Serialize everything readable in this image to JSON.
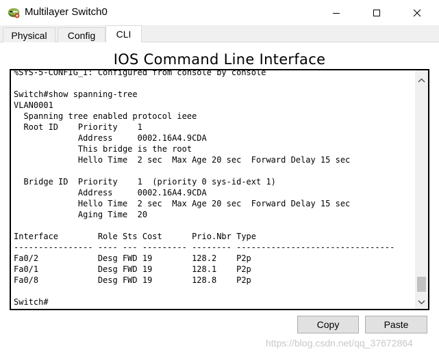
{
  "window": {
    "title": "Multilayer Switch0",
    "icon": "multilayer-switch-icon"
  },
  "tabs": [
    {
      "label": "Physical",
      "active": false
    },
    {
      "label": "Config",
      "active": false
    },
    {
      "label": "CLI",
      "active": true
    }
  ],
  "cli": {
    "heading": "IOS Command Line Interface",
    "lines": [
      "%SYS-5-CONFIG_I: Configured from console by console",
      "",
      "Switch#show spanning-tree",
      "VLAN0001",
      "  Spanning tree enabled protocol ieee",
      "  Root ID    Priority    1",
      "             Address     0002.16A4.9CDA",
      "             This bridge is the root",
      "             Hello Time  2 sec  Max Age 20 sec  Forward Delay 15 sec",
      "",
      "  Bridge ID  Priority    1  (priority 0 sys-id-ext 1)",
      "             Address     0002.16A4.9CDA",
      "             Hello Time  2 sec  Max Age 20 sec  Forward Delay 15 sec",
      "             Aging Time  20",
      "",
      "Interface        Role Sts Cost      Prio.Nbr Type",
      "---------------- ---- --- --------- -------- --------------------------------",
      "Fa0/2            Desg FWD 19        128.2    P2p",
      "Fa0/1            Desg FWD 19        128.1    P2p",
      "Fa0/8            Desg FWD 19        128.8    P2p",
      "",
      "Switch#"
    ]
  },
  "buttons": {
    "copy": "Copy",
    "paste": "Paste"
  },
  "watermark": "https://blog.csdn.net/qq_37672864",
  "colors": {
    "titlebar": "#ffffff",
    "window_bg": "#f0f0f0",
    "terminal_border": "#000000",
    "button_bg": "#e1e1e1"
  }
}
